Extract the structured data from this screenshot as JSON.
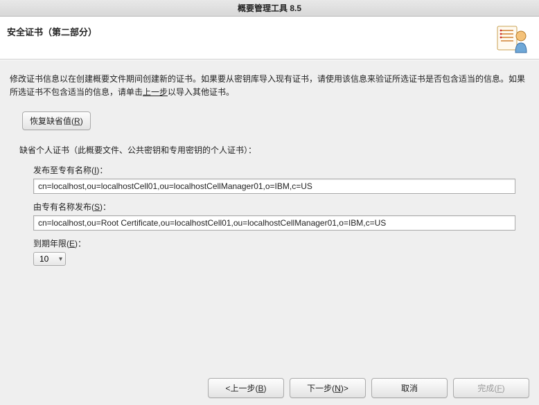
{
  "window": {
    "title": "概要管理工具 8.5"
  },
  "header": {
    "title": "安全证书（第二部分）"
  },
  "description": {
    "part1": "修改证书信息以在创建概要文件期间创建新的证书。如果要从密钥库导入现有证书，请使用该信息来验证所选证书是否包含适当的信息。如果所选证书不包含适当的信息，请单击",
    "underlined": "上一步",
    "part2": "以导入其他证书。"
  },
  "restore": {
    "label": "恢复缺省值",
    "mnemonic": "R"
  },
  "section": {
    "label": "缺省个人证书（此概要文件、公共密钥和专用密钥的个人证书）："
  },
  "fields": {
    "issuedTo": {
      "label": "发布至专有名称",
      "mnemonic": "I",
      "value": "cn=localhost,ou=localhostCell01,ou=localhostCellManager01,o=IBM,c=US"
    },
    "issuedBy": {
      "label": "由专有名称发布",
      "mnemonic": "S",
      "value": "cn=localhost,ou=Root Certificate,ou=localhostCell01,ou=localhostCellManager01,o=IBM,c=US"
    },
    "expiry": {
      "label": "到期年限",
      "mnemonic": "E",
      "value": "10"
    }
  },
  "footer": {
    "back": {
      "label": "<上一步",
      "mnemonic": "B"
    },
    "next": {
      "label": "下一步",
      "mnemonic": "N",
      "suffix": ">"
    },
    "cancel": {
      "label": "取消"
    },
    "finish": {
      "label": "完成",
      "mnemonic": "F"
    }
  }
}
